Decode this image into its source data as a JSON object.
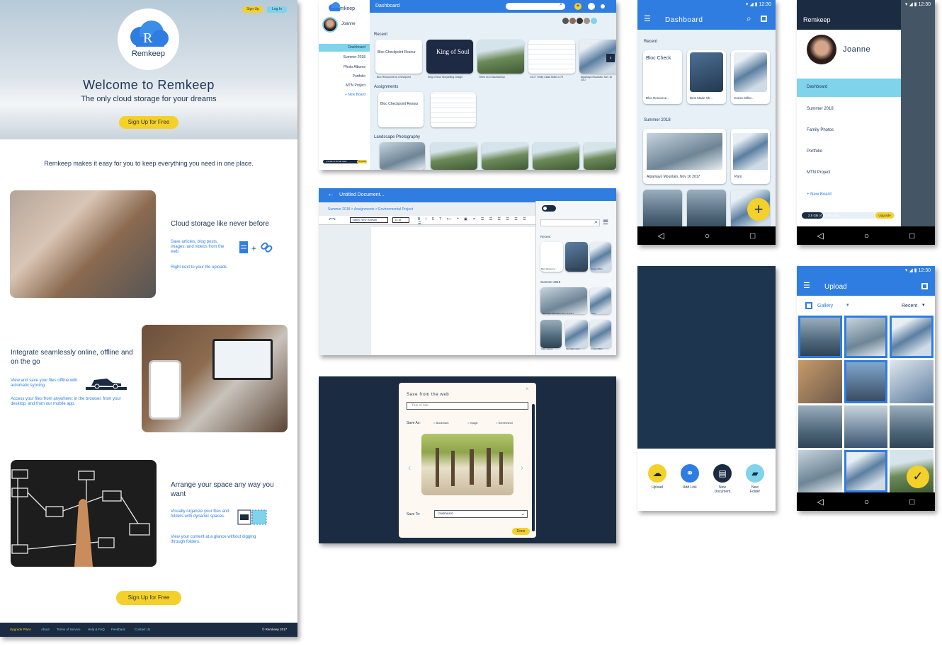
{
  "landing": {
    "signup_small": "Sign Up",
    "login_small": "Log In",
    "logo_text": "Remkeep",
    "hero_title": "Welcome to Remkeep",
    "hero_subtitle": "The only cloud storage for your dreams",
    "hero_cta": "Sign Up for Free",
    "intro": "Remkeep makes it easy for you to keep everything you need in one place.",
    "feature1_title": "Cloud storage like never before",
    "feature1_body": "Save articles, blog posts, images, and videos from the web",
    "feature1_note": "Right next to your file uploads.",
    "feature2_title": "Integrate seamlessly online, offline and on the go",
    "feature2_body": "View and save your files offline with automatic syncing.",
    "feature2_note": "Access your files from anywhere: in the browser, from your desktop, and from our mobile app.",
    "feature3_title": "Arrange your space any way you want",
    "feature3_body": "Visually organize your files and folders with dynamic spaces.",
    "feature3_note": "View your content at a glance without digging through folders.",
    "bottom_cta": "Sign Up for Free",
    "footer_links": [
      "Upgrade Plans",
      "About",
      "Terms of Service",
      "Help & FAQ",
      "Feedback",
      "Contact Us"
    ],
    "footer_copy": "© Remkeep 2017"
  },
  "desktop": {
    "logo_text": "mkeep",
    "user_name": "Joanne",
    "header_title": "Dashboard",
    "nav": [
      "Dashboard",
      "Summer 2018",
      "Photo Albums",
      "Portfolio",
      "MTN Project",
      "+ New Board"
    ],
    "usage": "1.5 GB of 15 GB used",
    "upgrade": "Upgrade",
    "section_recent": "Recent",
    "section_assignments": "Assignments",
    "section_landscape": "Landscape Photography",
    "recent_items": [
      "Bloc Resources by Checkpoint",
      "King of Soul Storytelling Design",
      "Trees on a Mountaintop",
      "13-17 Trinity Class Notes.n.79",
      "Alpamayo Mountain, Nov 16 2017"
    ],
    "recent_doc_title": "Bloc Checkpoint Resour",
    "king_text": "King of Soul",
    "assign_items": [
      "Bloc Resources by Checkpoint",
      "13-17 Trinity Class Notes.n.79"
    ]
  },
  "editor": {
    "title": "Untitled Document...",
    "breadcrumb": "Summer 2018 > Assignments > Environmental Project",
    "font": "Times New Roman",
    "size": "12 pt",
    "panel_recent": "Recent",
    "panel_summer": "Summer 2018",
    "items": [
      "Bloc Resource...",
      "Best Made Sh...",
      "Cruise Millor...",
      "Alpamayo Mountain, Nov 16 2017",
      "Paro",
      "Lake Jordan",
      "Mountain view...",
      "Cruise Millor..."
    ]
  },
  "modal": {
    "title": "Save from the web",
    "placeholder": "Title of link",
    "save_as": "Save As:",
    "options": [
      "Bookmark",
      "Image",
      "Screenshot"
    ],
    "save_to": "Save To:",
    "save_to_value": "Dashboard",
    "done": "Done"
  },
  "mobile_dash": {
    "time": "12:30",
    "title": "Dashboard",
    "recent": "Recent",
    "summer": "Summer 2018",
    "recent_items": [
      "Bloc Resource...",
      "Best Made Sh...",
      "Cruise Millor..."
    ],
    "summer_items": [
      "Alpamayo Mountain, Nov 16 2017",
      "Paro"
    ],
    "doc_title": "Bloc Check"
  },
  "mobile_drawer": {
    "time": "12:30",
    "title": "Remkeep",
    "user": "Joanne",
    "nav": [
      "Dashboard",
      "Summer 2018",
      "Family Photos",
      "Portfolio",
      "MTN Project",
      "+ New Board"
    ],
    "usage": "2.5 GB of 15 GB used",
    "upgrade": "Upgrade"
  },
  "mobile_actions": {
    "actions": [
      "Upload",
      "Add Link",
      "New Document",
      "New Folder"
    ]
  },
  "mobile_upload": {
    "time": "12:30",
    "title": "Upload",
    "gallery": "Gallery",
    "recent": "Recent"
  },
  "colors": {
    "primary": "#2f7de1",
    "yellow": "#f4d12a",
    "navy": "#1b2b41",
    "active_nav": "#7fd3ea"
  }
}
